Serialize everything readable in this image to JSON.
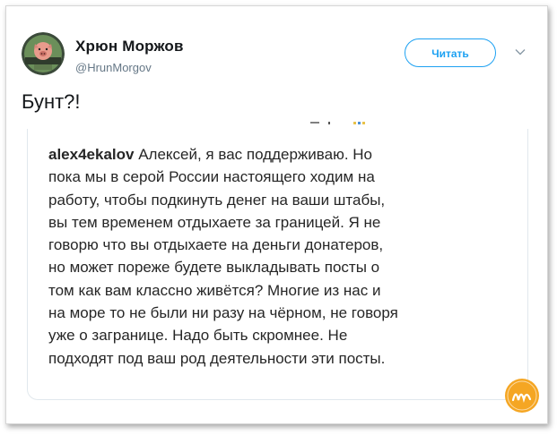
{
  "tweet": {
    "author": {
      "display_name": "Хрюн Моржов",
      "handle": "@HrunMorgov",
      "avatar_icon": "pig-avatar-icon"
    },
    "follow_button_label": "Читать",
    "menu_icon": "chevron-down-icon",
    "text": "Бунт?!",
    "colors": {
      "accent": "#1da1f2",
      "text": "#14171a",
      "muted": "#657786"
    }
  },
  "quoted_comment": {
    "username": "alex4ekalov",
    "lines": [
      " Алексей, я вас поддерживаю. Но",
      "пока мы в серой России настоящего ходим на",
      "работу, чтобы подкинуть денег на ваши штабы,",
      "вы тем временем отдыхаете за границей. Я не",
      "говорю что вы отдыхаете на деньги донатеров,",
      "но может пореже будете выкладывать посты о",
      "том как вам классно живётся? Многие из нас и",
      "на море то не были ни разу на чёрном, не говоря",
      "уже о загранице. Надо быть скромнее. Не",
      "подходят под ваш род деятельности эти посты."
    ]
  },
  "watermark": {
    "icon": "site-logo-icon",
    "color": "#f5a623"
  }
}
